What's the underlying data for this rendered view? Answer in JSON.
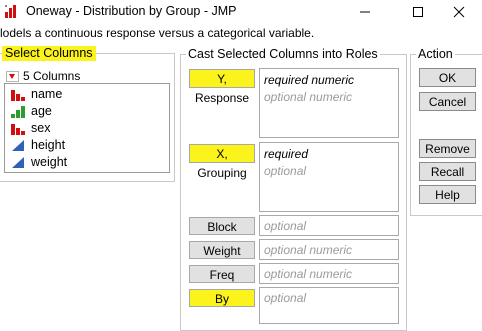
{
  "window": {
    "title": "Oneway - Distribution by Group - JMP",
    "minimize_icon": "minimize-icon",
    "maximize_icon": "maximize-icon",
    "close_icon": "close-icon"
  },
  "description": "lodels a continuous response versus a categorical variable.",
  "select_columns": {
    "label": "Select Columns",
    "count_label": "5 Columns",
    "items": [
      {
        "name": "name",
        "type_icon": "nominal-icon"
      },
      {
        "name": "age",
        "type_icon": "ordinal-icon"
      },
      {
        "name": "sex",
        "type_icon": "nominal-icon"
      },
      {
        "name": "height",
        "type_icon": "continuous-icon"
      },
      {
        "name": "weight",
        "type_icon": "continuous-icon"
      }
    ]
  },
  "cast_roles": {
    "label": "Cast Selected Columns into Roles",
    "roles": [
      {
        "button": "Y, Response",
        "line1": "required numeric",
        "line2": "optional numeric"
      },
      {
        "button": "X, Grouping",
        "line1": "required",
        "line2": "optional"
      },
      {
        "button": "Block",
        "line1": "optional"
      },
      {
        "button": "Weight",
        "line1": "optional numeric"
      },
      {
        "button": "Freq",
        "line1": "optional numeric"
      },
      {
        "button": "By",
        "line1": "optional"
      }
    ]
  },
  "action": {
    "label": "Action",
    "buttons": [
      "OK",
      "Cancel",
      "Remove",
      "Recall",
      "Help"
    ]
  },
  "colors": {
    "highlight": "#fcf21c",
    "nominal": "#d01010",
    "ordinal": "#2e9b2e",
    "continuous": "#2e62b8"
  }
}
